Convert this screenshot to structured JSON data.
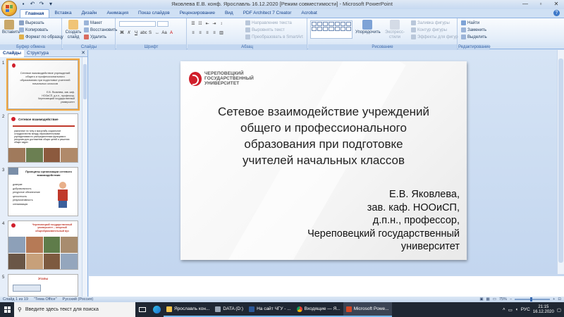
{
  "window": {
    "title": "Яковлева Е.В. конф. Ярославль 16.12.2020 [Режим совместимости] - Microsoft PowerPoint"
  },
  "tabs": [
    "Главная",
    "Вставка",
    "Дизайн",
    "Анимация",
    "Показ слайдов",
    "Рецензирование",
    "Вид",
    "PDF Architect 7 Creator",
    "Acrobat"
  ],
  "ribbon": {
    "clipboard": {
      "paste": "Вставить",
      "cut": "Вырезать",
      "copy": "Копировать",
      "format_painter": "Формат по образцу",
      "label": "Буфер обмена"
    },
    "slides": {
      "new_slide": "Создать слайд",
      "layout": "Макет",
      "reset": "Восстановить",
      "delete": "Удалить",
      "label": "Слайды"
    },
    "font": {
      "label": "Шрифт"
    },
    "paragraph": {
      "text_direction": "Направление текста",
      "align_text": "Выровнять текст",
      "smartart": "Преобразовать в SmartArt",
      "label": "Абзац"
    },
    "drawing": {
      "arrange": "Упорядочить",
      "quick_styles": "Экспресс-стили",
      "fill": "Заливка фигуры",
      "outline": "Контур фигуры",
      "effects": "Эффекты для фигур",
      "label": "Рисование"
    },
    "editing": {
      "find": "Найти",
      "replace": "Заменить",
      "select": "Выделить",
      "label": "Редактирование"
    }
  },
  "panel": {
    "tab_slides": "Слайды",
    "tab_outline": "Структура",
    "thumbs": [
      {
        "num": "1",
        "title": "Сетевое взаимодействие учреждений общего и профессионального образования при подготовке учителей начальных классов",
        "author": "Е.В. Яковлева, зав. каф. НООиСП, д.п.н., профессор, Череповецкий государственный университет"
      },
      {
        "num": "2",
        "title": "Сетевое взаимодействие",
        "text": "различное по типу и масштабу социальное сотрудничество между образовательными учреждениями по распределенным функциям и ресурсам для достижения общих целей и решения общих задач"
      },
      {
        "num": "3",
        "title": "Принципы организации сетевого взаимодействия",
        "bullets": [
          "доверие",
          "добровольность",
          "ресурсное обеспечение",
          "целостность",
          "результативность",
          "оптимизация"
        ]
      },
      {
        "num": "4",
        "title": "Череповецкий государственный университет – опорный общеобразовательный вуз"
      },
      {
        "num": "5",
        "title": "Этапы"
      }
    ]
  },
  "slide": {
    "logo_name": "ЧЕРЕПОВЕЦКИЙ ГОСУДАРСТВЕННЫЙ УНИВЕРСИТЕТ",
    "title_lines": [
      "Сетевое взаимодействие учреждений",
      "общего и профессионального",
      "образования при подготовке",
      "учителей начальных классов"
    ],
    "author_lines": [
      "Е.В. Яковлева,",
      "зав. каф. НООиСП,",
      "д.п.н., профессор,",
      "Череповецкий государственный",
      "университет"
    ]
  },
  "statusbar": {
    "slide_count": "Слайд 1 из 19",
    "theme": "\"Тема Office\"",
    "language": "Русский (Россия)",
    "zoom": "75%"
  },
  "taskbar": {
    "search_placeholder": "Введите здесь текст для поиска",
    "items": [
      {
        "label": "Ярославль кон...",
        "icon": "folder-icon"
      },
      {
        "label": "DATA (D:)",
        "icon": "drive-icon"
      },
      {
        "label": "На сайт ЧГУ - ...",
        "icon": "word-icon"
      },
      {
        "label": "Входящие — Я...",
        "icon": "chrome-icon"
      },
      {
        "label": "Microsoft Powe...",
        "icon": "powerpoint-icon"
      }
    ],
    "language": "РУС",
    "time": "21:15",
    "date": "16.12.2020"
  },
  "colors": {
    "accent": "#d01f2b",
    "ribbon": "#dfe9f5",
    "taskbar": "#1f2733"
  }
}
